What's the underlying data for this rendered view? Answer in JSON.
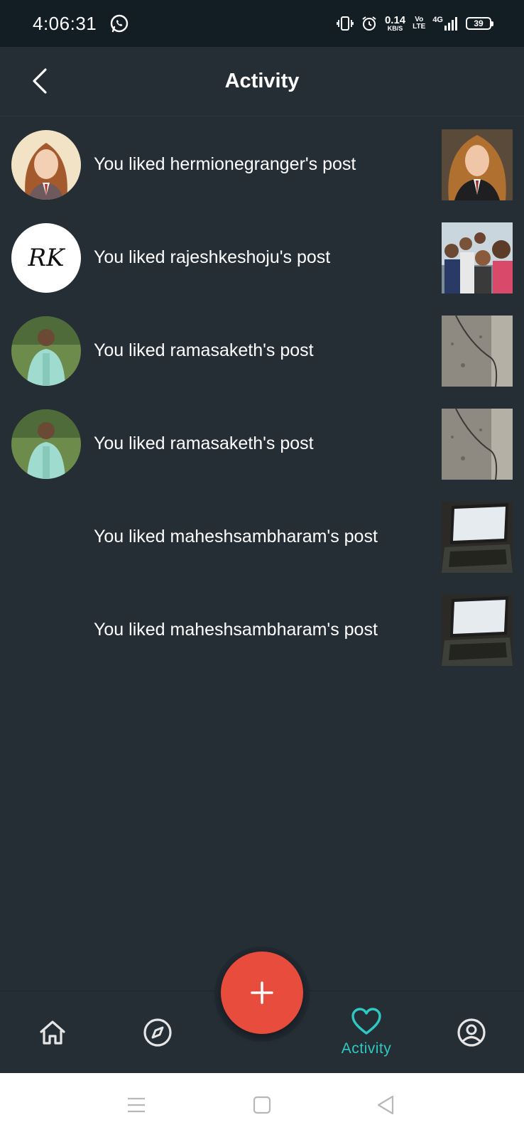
{
  "status_bar": {
    "time": "4:06:31",
    "speed_value": "0.14",
    "speed_unit": "KB/S",
    "volte_top": "Vo",
    "volte_bottom": "LTE",
    "network": "4G",
    "battery": "39"
  },
  "header": {
    "title": "Activity"
  },
  "activities": [
    {
      "text": "You liked hermionegranger's post",
      "avatar": "hermione",
      "thumb": "hermione"
    },
    {
      "text": "You liked rajeshkeshoju's post",
      "avatar": "rk-logo",
      "thumb": "group-selfie"
    },
    {
      "text": "You liked ramasaketh's post",
      "avatar": "man-green-shirt",
      "thumb": "stone-wall"
    },
    {
      "text": "You liked ramasaketh's post",
      "avatar": "man-green-shirt",
      "thumb": "stone-wall"
    },
    {
      "text": "You liked maheshsambharam's post",
      "avatar": "none",
      "thumb": "laptop"
    },
    {
      "text": "You liked maheshsambharam's post",
      "avatar": "none",
      "thumb": "laptop"
    }
  ],
  "bottom_nav": {
    "active_label": "Activity",
    "active_color": "#2ec9c2",
    "fab_color": "#e74c3c"
  },
  "theme": {
    "background": "#252d35",
    "status_bar": "#131d24"
  }
}
